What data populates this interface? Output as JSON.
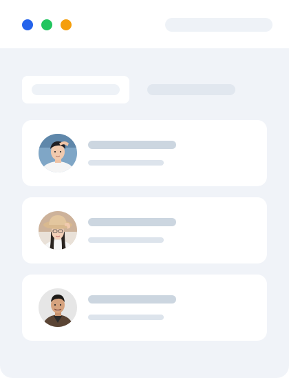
{
  "theme": {
    "dot_colors": [
      "#2563eb",
      "#22c55e",
      "#f59e0b"
    ],
    "content_bg": "#f0f3f8",
    "placeholder_dark": "#ccd6e0",
    "placeholder_light": "#dde4ec"
  },
  "window_controls": [
    {
      "icon": "blue-dot-icon"
    },
    {
      "icon": "green-dot-icon"
    },
    {
      "icon": "orange-dot-icon"
    }
  ],
  "tabs": [
    {
      "state": "active"
    },
    {
      "state": "inactive"
    }
  ],
  "cards": [
    {
      "avatar": "avatar-photo-man-hand-on-head",
      "avatar_bg": "#7fa6c6"
    },
    {
      "avatar": "avatar-photo-woman-straw-hat",
      "avatar_bg": "#cdb29a"
    },
    {
      "avatar": "avatar-photo-man-smiling",
      "avatar_bg": "#e6e6e6"
    }
  ]
}
